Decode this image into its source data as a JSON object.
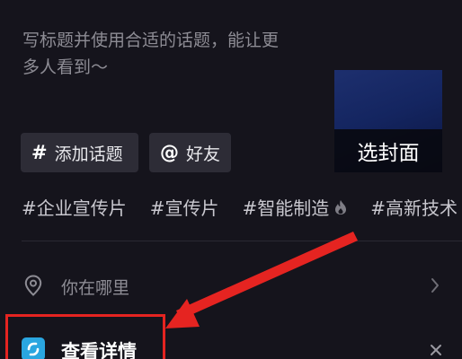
{
  "caption": {
    "placeholder_line1": "写标题并使用合适的话题，能让更",
    "placeholder_line2": "多人看到～"
  },
  "cover": {
    "label": "选封面"
  },
  "buttons": {
    "add_topic_icon": "#",
    "add_topic_label": "添加话题",
    "mention_icon": "@",
    "mention_label": "好友"
  },
  "tags": [
    "#企业宣传片",
    "#宣传片",
    "#智能制造",
    "#高新技术"
  ],
  "location": {
    "label": "你在哪里",
    "icon": "map-pin-icon"
  },
  "detail": {
    "label": "查看详情",
    "icon": "link-app-icon"
  },
  "colors": {
    "background": "#15141c",
    "button_bg": "#2d2c36",
    "highlight_red": "#e52421",
    "cover_blue": "#142560",
    "app_icon_blue": "#2aa6e0"
  }
}
